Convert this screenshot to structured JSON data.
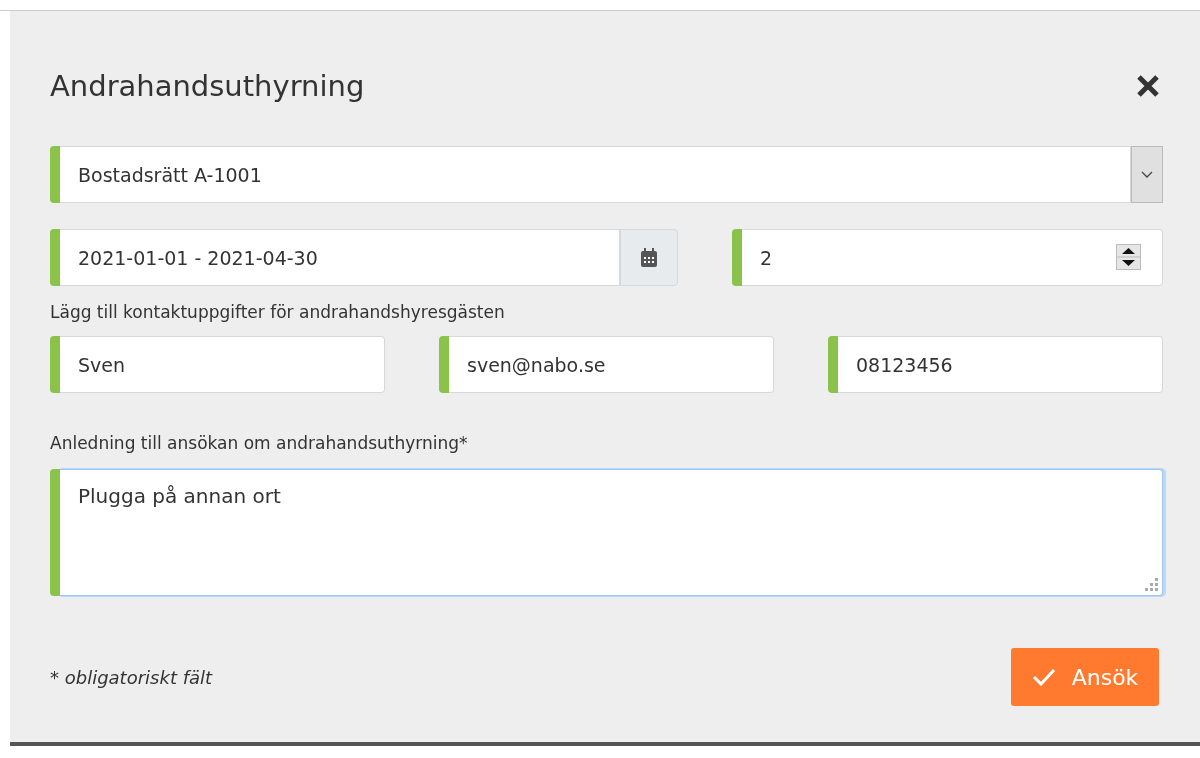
{
  "dialog": {
    "title": "Andrahandsuthyrning",
    "property_select": {
      "value": "Bostadsrätt A-1001"
    },
    "period_field": {
      "value": "2021-01-01 - 2021-04-30"
    },
    "count_field": {
      "value": "2"
    },
    "contact_label": "Lägg till kontaktuppgifter för andrahandshyresgästen",
    "contact_fields": [
      {
        "value": "Sven"
      },
      {
        "value": "sven@nabo.se"
      },
      {
        "value": "08123456"
      }
    ],
    "reason_label": "Anledning till ansökan om andrahandsuthyrning*",
    "reason_field": {
      "value": "Plugga på annan ort",
      "focused": true
    },
    "required_note": "* obligatoriskt fält",
    "submit_button": {
      "label": "Ansök"
    }
  }
}
